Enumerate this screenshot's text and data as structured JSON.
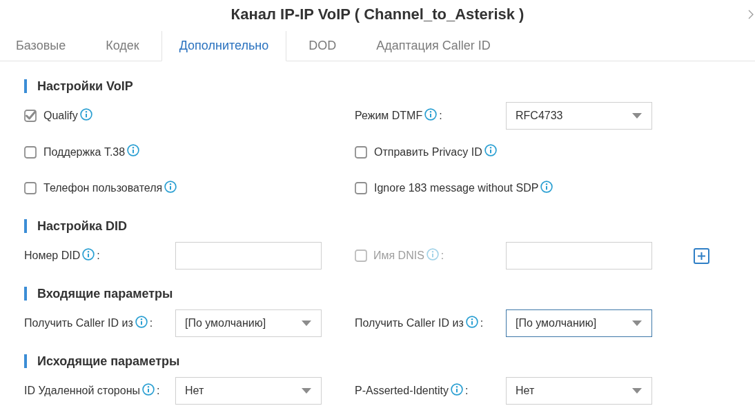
{
  "dialog": {
    "title": "Канал IP-IP VoIP ( Channel_to_Asterisk )"
  },
  "tabs": [
    {
      "label": "Базовые",
      "selected": false
    },
    {
      "label": "Кодек",
      "selected": false
    },
    {
      "label": "Дополнительно",
      "selected": true
    },
    {
      "label": "DOD",
      "selected": false
    },
    {
      "label": "Адаптация Caller ID",
      "selected": false
    }
  ],
  "sections": [
    {
      "title": "Настройки VoIP",
      "rows": [
        {
          "items": [
            {
              "kind": "checkbox",
              "label": "Qualify",
              "checked": true,
              "disabled": false
            },
            {
              "kind": "select",
              "label": "Режим DTMF",
              "suffix": ":",
              "value": "RFC4733",
              "focused": false
            }
          ]
        },
        {
          "items": [
            {
              "kind": "checkbox",
              "label": "Поддержка T.38",
              "checked": false,
              "disabled": false
            },
            {
              "kind": "checkbox",
              "label": "Отправить Privacy ID",
              "checked": false,
              "disabled": false
            }
          ]
        },
        {
          "items": [
            {
              "kind": "checkbox",
              "label": "Телефон пользователя",
              "checked": false,
              "disabled": false
            },
            {
              "kind": "checkbox",
              "label": "Ignore 183 message without SDP",
              "checked": false,
              "disabled": false
            }
          ]
        }
      ]
    },
    {
      "title": "Настройка DID",
      "rows": [
        {
          "items": [
            {
              "kind": "input",
              "label": "Номер DID",
              "suffix": ":"
            },
            {
              "kind": "checkbox_input",
              "label": "Имя DNIS",
              "suffix": ":",
              "checked": false,
              "disabled": true
            },
            {
              "kind": "add"
            }
          ]
        }
      ]
    },
    {
      "title": "Входящие параметры",
      "rows": [
        {
          "items": [
            {
              "kind": "select",
              "label": "Получить Caller ID из",
              "suffix": ":",
              "value": "[По умолчанию]",
              "focused": false
            },
            {
              "kind": "select",
              "label": "Получить Caller ID из",
              "suffix": ":",
              "value": "[По умолчанию]",
              "focused": true
            }
          ]
        }
      ]
    },
    {
      "title": "Исходящие параметры",
      "rows": [
        {
          "items": [
            {
              "kind": "select",
              "label": "ID Удаленной стороны",
              "suffix": ":",
              "value": "Нет",
              "focused": false
            },
            {
              "kind": "select",
              "label": "P-Asserted-Identity",
              "suffix": ":",
              "value": "Нет",
              "focused": false
            }
          ]
        }
      ]
    }
  ]
}
